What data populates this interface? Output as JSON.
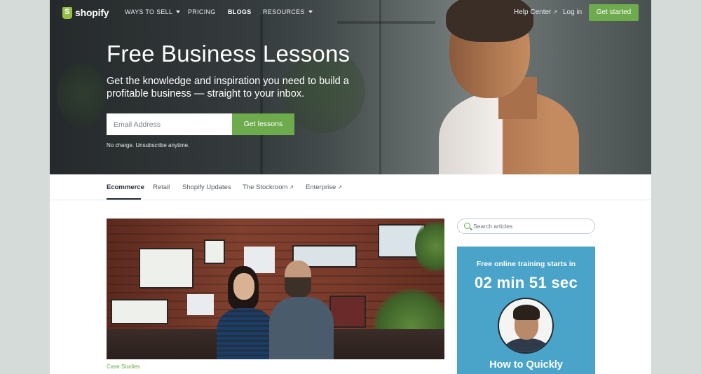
{
  "nav": {
    "logo": "shopify",
    "items": [
      {
        "label": "WAYS TO SELL",
        "dropdown": true
      },
      {
        "label": "PRICING",
        "dropdown": false
      },
      {
        "label": "BLOGS",
        "dropdown": false,
        "active": true
      },
      {
        "label": "RESOURCES",
        "dropdown": true
      }
    ],
    "help": "Help Center",
    "login": "Log in",
    "cta": "Get started",
    "external_glyph": "↗"
  },
  "hero": {
    "title": "Free Business Lessons",
    "subtitle": "Get the knowledge and inspiration you need to build a profitable business — straight to your inbox.",
    "email_placeholder": "Email Address",
    "button": "Get lessons",
    "note": "No charge. Unsubscribe anytime."
  },
  "tabs": [
    {
      "label": "Ecommerce",
      "active": true
    },
    {
      "label": "Retail"
    },
    {
      "label": "Shopify Updates"
    },
    {
      "label": "The Stockroom",
      "external": true
    },
    {
      "label": "Enterprise",
      "external": true
    }
  ],
  "article": {
    "category": "Case Studies"
  },
  "sidebar": {
    "search_placeholder": "Search articles",
    "promo": {
      "kicker": "Free online training starts in",
      "timer": "02 min 51 sec",
      "headline": "How to Quickly"
    }
  },
  "colors": {
    "accent": "#6dab4c",
    "promo": "#4aa3c9",
    "page_bg": "#d5dbd9"
  }
}
